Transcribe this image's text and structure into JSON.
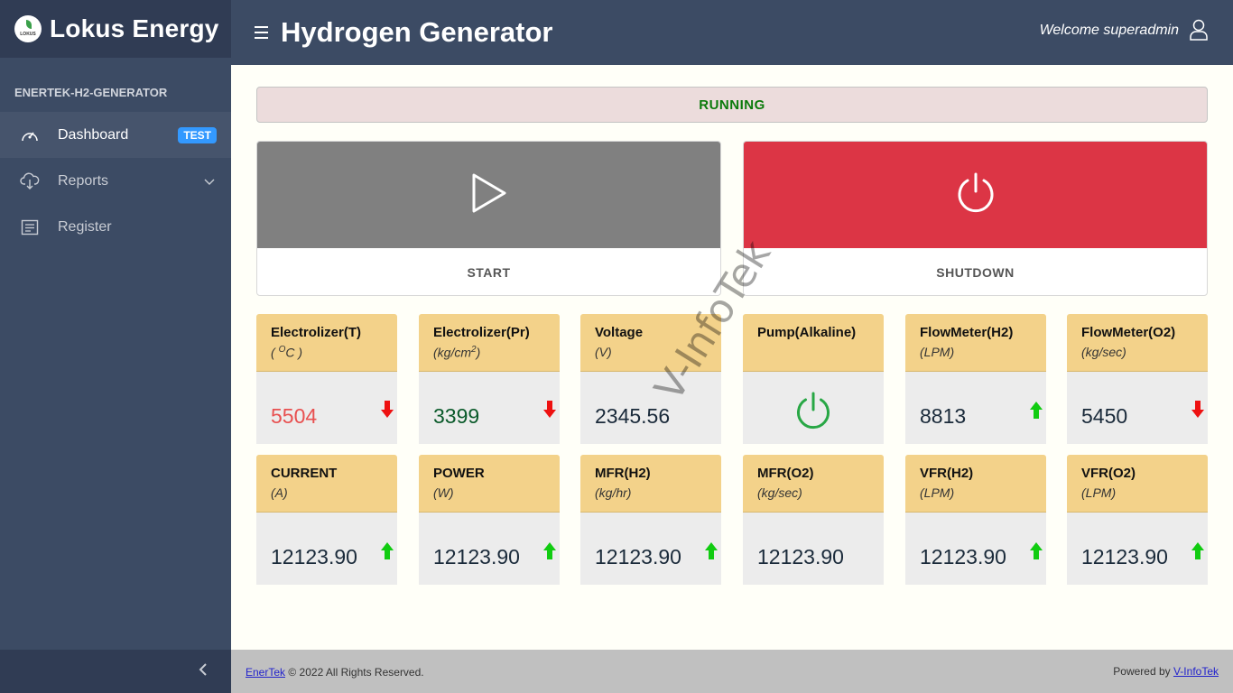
{
  "brand": {
    "name": "Lokus Energy",
    "logo_text": "LOKUS"
  },
  "sidebar": {
    "title": "ENERTEK-H2-GENERATOR",
    "items": [
      {
        "label": "Dashboard",
        "icon": "speedometer-icon",
        "badge": "TEST"
      },
      {
        "label": "Reports",
        "icon": "cloud-download-icon"
      },
      {
        "label": "Register",
        "icon": "list-icon"
      }
    ]
  },
  "header": {
    "title": "Hydrogen Generator",
    "welcome": "Welcome superadmin"
  },
  "status": {
    "text": "RUNNING",
    "color": "#0a7a0a"
  },
  "controls": {
    "start_label": "START",
    "shutdown_label": "SHUTDOWN"
  },
  "cards_row1": [
    {
      "name": "Electrolizer(T)",
      "unit_pre": "( ",
      "unit_sup": "O",
      "unit_post": "C )",
      "value": "5504",
      "value_color": "#e85050",
      "trend": "down"
    },
    {
      "name": "Electrolizer(Pr)",
      "unit_pre": "(kg/cm",
      "unit_sup": "2",
      "unit_post": ")",
      "value": "3399",
      "value_color": "#0a5a2a",
      "trend": "down"
    },
    {
      "name": "Voltage",
      "unit": "(V)",
      "value": "2345.56",
      "value_color": "#1a2a3a",
      "trend": "none"
    },
    {
      "name": "Pump(Alkaline)",
      "unit": "",
      "value": "",
      "trend": "none",
      "icon": "power-icon"
    },
    {
      "name": "FlowMeter(H2)",
      "unit": "(LPM)",
      "value": "8813",
      "value_color": "#1a2a3a",
      "trend": "up"
    },
    {
      "name": "FlowMeter(O2)",
      "unit": "(kg/sec)",
      "value": "5450",
      "value_color": "#1a2a3a",
      "trend": "down"
    }
  ],
  "cards_row2": [
    {
      "name": "CURRENT",
      "unit": "(A)",
      "value": "12123.90",
      "trend": "up"
    },
    {
      "name": "POWER",
      "unit": "(W)",
      "value": "12123.90",
      "trend": "up"
    },
    {
      "name": "MFR(H2)",
      "unit": "(kg/hr)",
      "value": "12123.90",
      "trend": "up"
    },
    {
      "name": "MFR(O2)",
      "unit": "(kg/sec)",
      "value": "12123.90",
      "trend": "none"
    },
    {
      "name": "VFR(H2)",
      "unit": "(LPM)",
      "value": "12123.90",
      "trend": "up"
    },
    {
      "name": "VFR(O2)",
      "unit": "(LPM)",
      "value": "12123.90",
      "trend": "up"
    }
  ],
  "footer": {
    "left_link": "EnerTek",
    "left_text": " © 2022 All Rights Reserved.",
    "right_text": "Powered by ",
    "right_link": "V-InfoTek"
  },
  "watermark": "V-InfoTek",
  "colors": {
    "sidebar": "#3c4b64",
    "card_head": "#f3d28a",
    "shutdown": "#dc3545",
    "trend_up": "#11cc11",
    "trend_down": "#ee1111"
  }
}
